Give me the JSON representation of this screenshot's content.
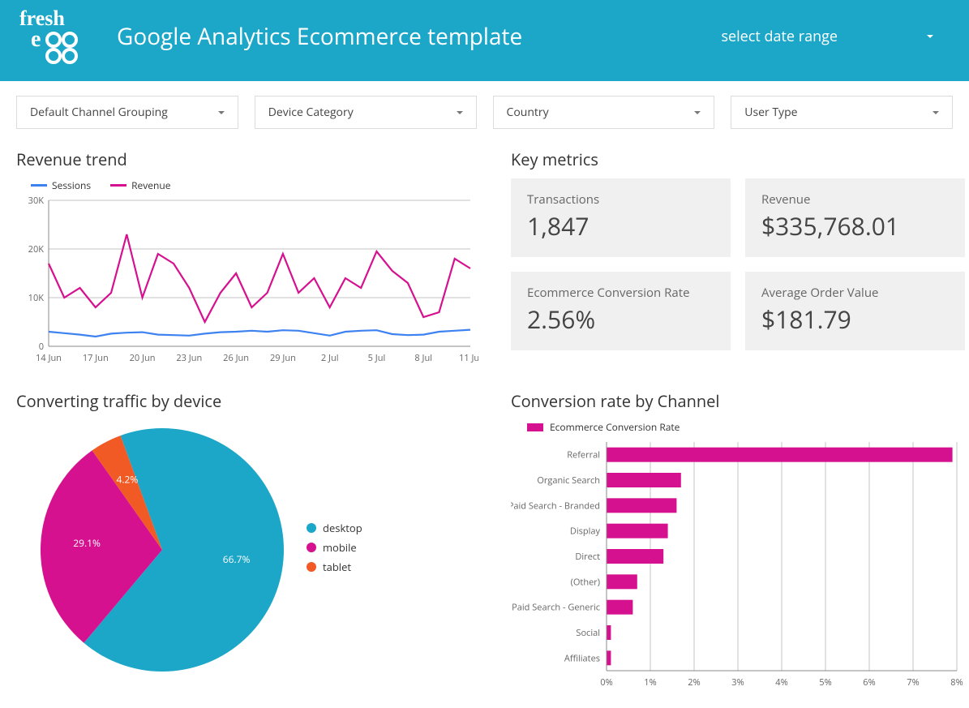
{
  "header": {
    "logo_text": "fresh egg",
    "title": "Google Analytics Ecommerce template",
    "date_range_label": "select date range"
  },
  "filters": {
    "channel": "Default Channel Grouping",
    "device": "Device Category",
    "country": "Country",
    "user_type": "User Type"
  },
  "sections": {
    "revenue_trend_title": "Revenue trend",
    "key_metrics_title": "Key metrics",
    "converting_traffic_title": "Converting traffic by device",
    "conversion_channel_title": "Conversion rate by Channel"
  },
  "metrics": {
    "transactions_label": "Transactions",
    "transactions_value": "1,847",
    "revenue_label": "Revenue",
    "revenue_value": "$335,768.01",
    "conv_rate_label": "Ecommerce Conversion Rate",
    "conv_rate_value": "2.56%",
    "aov_label": "Average Order Value",
    "aov_value": "$181.79"
  },
  "line_legend": {
    "s1": "Sessions",
    "s2": "Revenue"
  },
  "pie_legend": {
    "desktop": "desktop",
    "mobile": "mobile",
    "tablet": "tablet"
  },
  "bar_legend": {
    "label": "Ecommerce Conversion Rate"
  },
  "colors": {
    "blue": "#1ca7c8",
    "magenta": "#d6118f",
    "orange": "#f15a24"
  },
  "chart_data": [
    {
      "id": "revenue_trend",
      "type": "line",
      "title": "Revenue trend",
      "xlabel": "",
      "ylabel": "",
      "ylim": [
        0,
        30000
      ],
      "y_ticks": [
        0,
        10000,
        20000,
        30000
      ],
      "y_tick_labels": [
        "0",
        "10K",
        "20K",
        "30K"
      ],
      "x_tick_labels": [
        "14 Jun",
        "17 Jun",
        "20 Jun",
        "23 Jun",
        "26 Jun",
        "29 Jun",
        "2 Jul",
        "5 Jul",
        "8 Jul",
        "11 Jul"
      ],
      "categories": [
        "14 Jun",
        "15 Jun",
        "16 Jun",
        "17 Jun",
        "18 Jun",
        "19 Jun",
        "20 Jun",
        "21 Jun",
        "22 Jun",
        "23 Jun",
        "24 Jun",
        "25 Jun",
        "26 Jun",
        "27 Jun",
        "28 Jun",
        "29 Jun",
        "30 Jun",
        "1 Jul",
        "2 Jul",
        "3 Jul",
        "4 Jul",
        "5 Jul",
        "6 Jul",
        "7 Jul",
        "8 Jul",
        "9 Jul",
        "10 Jul",
        "11 Jul"
      ],
      "series": [
        {
          "name": "Sessions",
          "color": "#3d82f0",
          "values": [
            3000,
            2700,
            2400,
            2000,
            2600,
            2800,
            2900,
            2400,
            2300,
            2200,
            2600,
            2900,
            3000,
            3200,
            3000,
            3300,
            3200,
            2700,
            2200,
            3000,
            3200,
            3300,
            2500,
            2300,
            2400,
            3000,
            3200,
            3400
          ]
        },
        {
          "name": "Revenue",
          "color": "#d6118f",
          "values": [
            17000,
            10000,
            12000,
            8000,
            11000,
            23000,
            10000,
            19000,
            17000,
            12000,
            5000,
            11000,
            15000,
            8000,
            11000,
            19000,
            11000,
            14000,
            8000,
            14000,
            12000,
            19500,
            15500,
            13000,
            6000,
            7000,
            18000,
            16000
          ]
        }
      ]
    },
    {
      "id": "converting_traffic_by_device",
      "type": "pie",
      "title": "Converting traffic by device",
      "series": [
        {
          "name": "desktop",
          "value": 66.7,
          "color": "#1ca7c8"
        },
        {
          "name": "mobile",
          "value": 29.1,
          "color": "#d6118f"
        },
        {
          "name": "tablet",
          "value": 4.2,
          "color": "#f15a24"
        }
      ]
    },
    {
      "id": "conversion_rate_by_channel",
      "type": "bar",
      "orientation": "horizontal",
      "title": "Conversion rate by Channel",
      "xlabel": "",
      "ylabel": "",
      "xlim": [
        0,
        8
      ],
      "x_ticks": [
        0,
        1,
        2,
        3,
        4,
        5,
        6,
        7,
        8
      ],
      "x_tick_labels": [
        "0%",
        "1%",
        "2%",
        "3%",
        "4%",
        "5%",
        "6%",
        "7%",
        "8%"
      ],
      "legend": "Ecommerce Conversion Rate",
      "categories": [
        "Referral",
        "Organic Search",
        "Paid Search - Branded",
        "Display",
        "Direct",
        "(Other)",
        "Paid Search - Generic",
        "Social",
        "Affiliates"
      ],
      "values": [
        7.9,
        1.7,
        1.6,
        1.4,
        1.3,
        0.7,
        0.6,
        0.1,
        0.1
      ],
      "color": "#d6118f"
    }
  ]
}
